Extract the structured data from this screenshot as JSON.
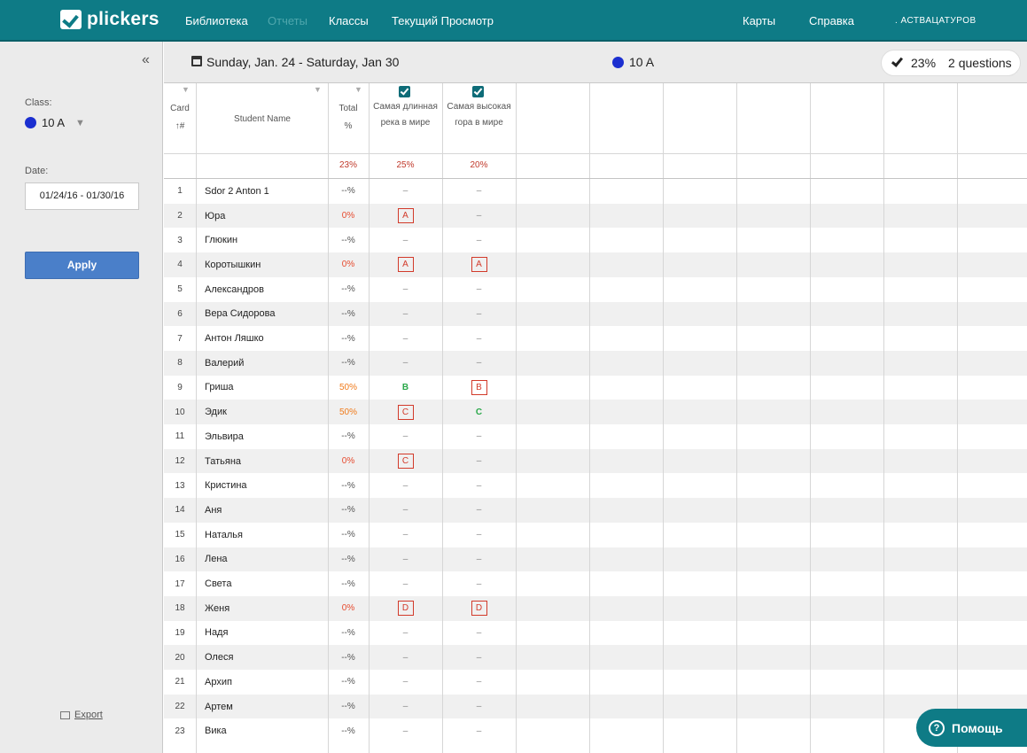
{
  "nav": {
    "logo": "plickers",
    "items": [
      "Библиотека",
      "Отчеты",
      "Классы",
      "Текущий Просмотр"
    ],
    "right_items": [
      "Карты",
      "Справка"
    ],
    "user": ". АСТВАЦАТУРОВ"
  },
  "sidebar": {
    "class_label": "Class:",
    "class_value": "10 A",
    "date_label": "Date:",
    "date_value": "01/24/16 - 01/30/16",
    "apply_label": "Apply",
    "export_label": "Export"
  },
  "header": {
    "date_range": "Sunday, Jan. 24 - Saturday, Jan 30",
    "class_name": "10 A",
    "summary_pct": "23%",
    "summary_questions": "2 questions"
  },
  "table": {
    "col_card": "Card",
    "col_card_sub": "↑#",
    "col_name": "Student Name",
    "col_total": "Total",
    "col_total_sub": "%",
    "questions": [
      {
        "title": "Самая длинная река в мире",
        "pct": "25%"
      },
      {
        "title": "Самая высокая гора в мире",
        "pct": "20%"
      }
    ],
    "total_pct": "23%",
    "rows": [
      {
        "card": "1",
        "name": "Sdor 2 Anton 1",
        "total": "--%",
        "q1": "–",
        "q2": "–"
      },
      {
        "card": "2",
        "name": "Юра",
        "total": "0%",
        "q1": "A",
        "q2": "–"
      },
      {
        "card": "3",
        "name": "Глюкин",
        "total": "--%",
        "q1": "–",
        "q2": "–"
      },
      {
        "card": "4",
        "name": "Коротышкин",
        "total": "0%",
        "q1": "A",
        "q2": "A"
      },
      {
        "card": "5",
        "name": "Александров",
        "total": "--%",
        "q1": "–",
        "q2": "–"
      },
      {
        "card": "6",
        "name": "Вера Сидорова",
        "total": "--%",
        "q1": "–",
        "q2": "–"
      },
      {
        "card": "7",
        "name": "Антон Ляшко",
        "total": "--%",
        "q1": "–",
        "q2": "–"
      },
      {
        "card": "8",
        "name": "Валерий",
        "total": "--%",
        "q1": "–",
        "q2": "–"
      },
      {
        "card": "9",
        "name": "Гриша",
        "total": "50%",
        "q1": "B",
        "q2": "B"
      },
      {
        "card": "10",
        "name": "Эдик",
        "total": "50%",
        "q1": "C",
        "q2": "C"
      },
      {
        "card": "11",
        "name": "Эльвира",
        "total": "--%",
        "q1": "–",
        "q2": "–"
      },
      {
        "card": "12",
        "name": "Татьяна",
        "total": "0%",
        "q1": "C",
        "q2": "–"
      },
      {
        "card": "13",
        "name": "Кристина",
        "total": "--%",
        "q1": "–",
        "q2": "–"
      },
      {
        "card": "14",
        "name": "Аня",
        "total": "--%",
        "q1": "–",
        "q2": "–"
      },
      {
        "card": "15",
        "name": "Наталья",
        "total": "--%",
        "q1": "–",
        "q2": "–"
      },
      {
        "card": "16",
        "name": "Лена",
        "total": "--%",
        "q1": "–",
        "q2": "–"
      },
      {
        "card": "17",
        "name": "Света",
        "total": "--%",
        "q1": "–",
        "q2": "–"
      },
      {
        "card": "18",
        "name": "Женя",
        "total": "0%",
        "q1": "D",
        "q2": "D"
      },
      {
        "card": "19",
        "name": "Надя",
        "total": "--%",
        "q1": "–",
        "q2": "–"
      },
      {
        "card": "20",
        "name": "Олеся",
        "total": "--%",
        "q1": "–",
        "q2": "–"
      },
      {
        "card": "21",
        "name": "Архип",
        "total": "--%",
        "q1": "–",
        "q2": "–"
      },
      {
        "card": "22",
        "name": "Артем",
        "total": "--%",
        "q1": "–",
        "q2": "–"
      },
      {
        "card": "23",
        "name": "Вика",
        "total": "--%",
        "q1": "–",
        "q2": "–"
      }
    ]
  },
  "help_label": "Помощь",
  "colors": {
    "brand": "#0e7b86",
    "wrong": "#d23a2a",
    "correct": "#2aa84a",
    "class_dot": "#1b2fd0"
  }
}
